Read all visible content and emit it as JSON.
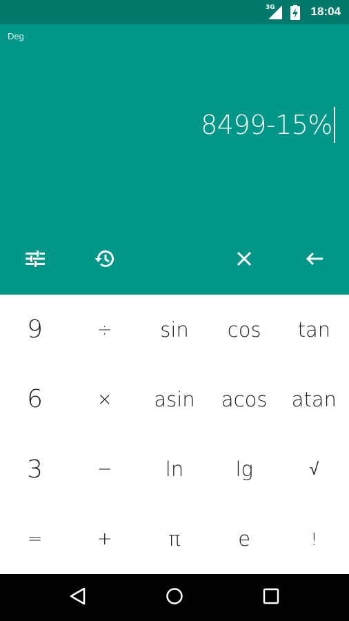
{
  "status_bar": {
    "network": "3G",
    "time": "18:04"
  },
  "display": {
    "angle_mode": "Deg",
    "expression": "8499-15%"
  },
  "keypad": {
    "rows": [
      [
        "9",
        "÷",
        "sin",
        "cos",
        "tan"
      ],
      [
        "6",
        "×",
        "asin",
        "acos",
        "atan"
      ],
      [
        "3",
        "−",
        "ln",
        "lg",
        "√"
      ],
      [
        "=",
        "+",
        "π",
        "e",
        "!"
      ]
    ]
  },
  "colors": {
    "status_bar": "#00796b",
    "display": "#009688",
    "key_text": "#212121"
  }
}
